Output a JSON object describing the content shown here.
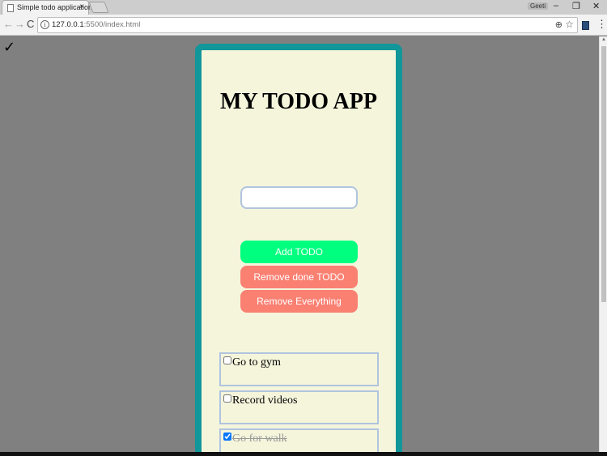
{
  "browser": {
    "tab_title": "Simple todo application",
    "tab_close": "×",
    "user_badge": "Geeti",
    "win_minimize": "–",
    "win_restore": "❐",
    "win_close": "✕",
    "nav_back": "←",
    "nav_forward": "→",
    "nav_reload": "C",
    "url_host": "127.0.0.1",
    "url_path": ":5500/index.html",
    "info_icon": "i",
    "zoom_icon": "⊕",
    "star_icon": "☆",
    "menu_icon": "⋮"
  },
  "page": {
    "corner_mark": "✓"
  },
  "app": {
    "title": "MY TODO APP",
    "input_value": "",
    "input_placeholder": "",
    "buttons": {
      "add": "Add TODO",
      "remove_done": "Remove done TODO",
      "remove_all": "Remove Everything"
    },
    "todos": [
      {
        "text": "Go to gym",
        "done": false
      },
      {
        "text": "Record videos",
        "done": false
      },
      {
        "text": "Go for walk",
        "done": true
      }
    ]
  },
  "colors": {
    "card_border": "#11969a",
    "card_bg": "#f5f5dc",
    "add_button": "#00ff7f",
    "remove_button": "#fa8072",
    "page_bg": "#808080"
  }
}
